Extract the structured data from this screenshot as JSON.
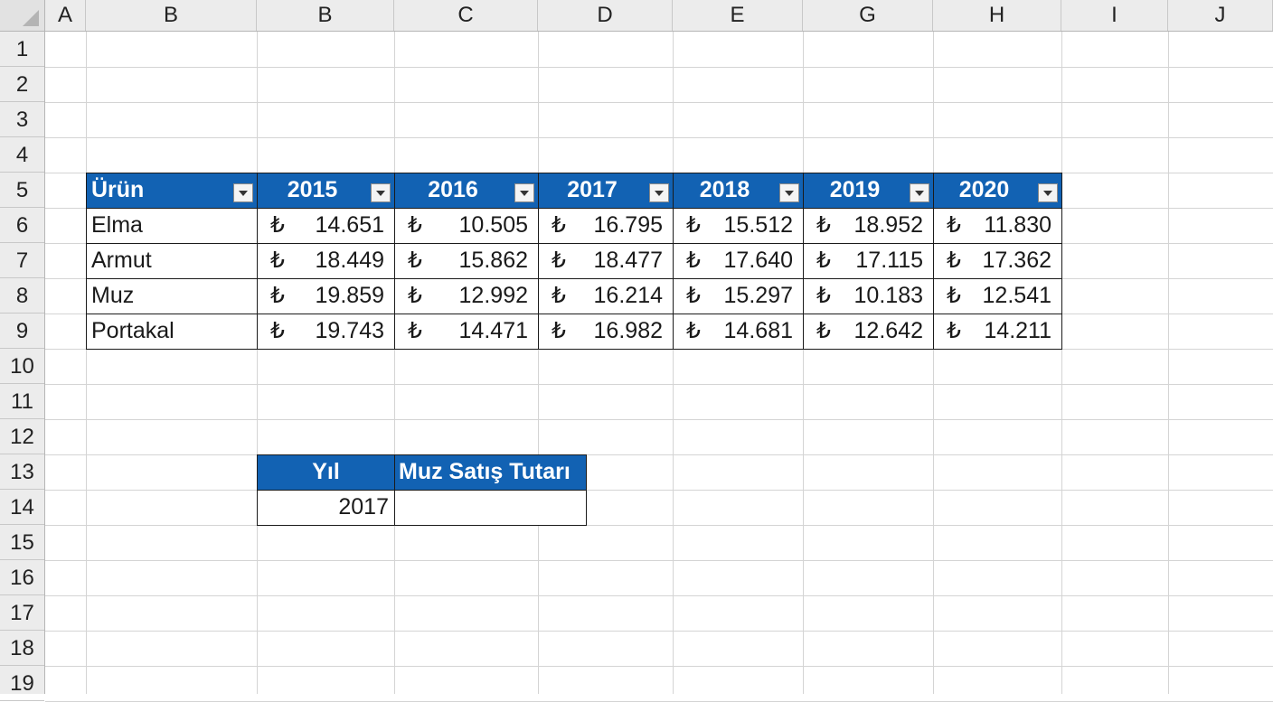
{
  "columns": [
    "A",
    "B",
    "B",
    "C",
    "D",
    "E",
    "G",
    "H",
    "I",
    "J"
  ],
  "rows": [
    "1",
    "2",
    "3",
    "4",
    "5",
    "6",
    "7",
    "8",
    "9",
    "10",
    "11",
    "12",
    "13",
    "14",
    "15",
    "16",
    "17",
    "18",
    "19"
  ],
  "sales_table": {
    "header_color": "#1262b3",
    "product_header": "Ürün",
    "years": [
      "2015",
      "2016",
      "2017",
      "2018",
      "2019",
      "2020"
    ],
    "currency_symbol": "₺",
    "rows": [
      {
        "product": "Elma",
        "values": [
          "14.651",
          "10.505",
          "16.795",
          "15.512",
          "18.952",
          "11.830"
        ]
      },
      {
        "product": "Armut",
        "values": [
          "18.449",
          "15.862",
          "18.477",
          "17.640",
          "17.115",
          "17.362"
        ]
      },
      {
        "product": "Muz",
        "values": [
          "19.859",
          "12.992",
          "16.214",
          "15.297",
          "10.183",
          "12.541"
        ]
      },
      {
        "product": "Portakal",
        "values": [
          "19.743",
          "14.471",
          "16.982",
          "14.681",
          "12.642",
          "14.211"
        ]
      }
    ]
  },
  "lookup_table": {
    "year_header": "Yıl",
    "result_header": "Muz Satış Tutarı",
    "year_value": "2017",
    "result_value": ""
  }
}
